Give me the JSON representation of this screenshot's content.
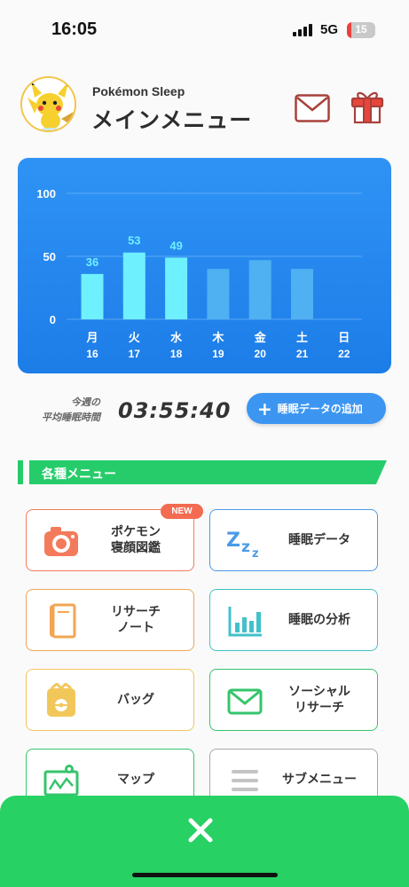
{
  "status_bar": {
    "time": "16:05",
    "network": "5G",
    "battery": "15",
    "battery_level": 0.15
  },
  "header": {
    "app_name": "Pokémon Sleep",
    "title": "メインメニュー",
    "mail_icon": "mail-icon",
    "gift_icon": "gift-icon"
  },
  "chart_data": {
    "type": "bar",
    "ylim": [
      0,
      100
    ],
    "yticks": [
      0,
      50,
      100
    ],
    "categories": [
      {
        "day": "月",
        "date": "16"
      },
      {
        "day": "火",
        "date": "17"
      },
      {
        "day": "水",
        "date": "18"
      },
      {
        "day": "木",
        "date": "19"
      },
      {
        "day": "金",
        "date": "20"
      },
      {
        "day": "土",
        "date": "21"
      },
      {
        "day": "日",
        "date": "22"
      }
    ],
    "values": [
      36,
      53,
      49,
      40,
      47,
      40,
      null
    ],
    "value_labels": [
      "36",
      "53",
      "49",
      "",
      "",
      "",
      ""
    ],
    "highlighted": [
      true,
      true,
      true,
      false,
      false,
      false,
      false
    ],
    "colors": {
      "highlight": "#6ff0ff",
      "normal": "#4fb0f2",
      "grid": "#7fc0f8",
      "text": "#ffffff"
    },
    "grid": true
  },
  "sleep_summary": {
    "label": "今週の\n平均睡眠時間",
    "value": "03:55:40"
  },
  "add_button": {
    "label": "睡眠データの追加",
    "icon": "plus-icon"
  },
  "section": {
    "title": "各種メニュー"
  },
  "menu": {
    "items": [
      {
        "label": "ポケモン\n寝顔図鑑",
        "icon": "camera-icon",
        "border": "#f47a5c",
        "badge": "NEW"
      },
      {
        "label": "睡眠データ",
        "icon": "zzz-icon",
        "border": "#4b9be8"
      },
      {
        "label": "リサーチ\nノート",
        "icon": "notebook-icon",
        "border": "#f2a654"
      },
      {
        "label": "睡眠の分析",
        "icon": "bar-chart-icon",
        "border": "#41c1c9"
      },
      {
        "label": "バッグ",
        "icon": "bag-icon",
        "border": "#f2c75a"
      },
      {
        "label": "ソーシャル\nリサーチ",
        "icon": "envelope-icon",
        "border": "#35c46b"
      },
      {
        "label": "マップ",
        "icon": "map-icon",
        "border": "#35c46b"
      },
      {
        "label": "サブメニュー",
        "icon": "hamburger-icon",
        "border": "#a8a8a8"
      }
    ]
  },
  "close_panel": {
    "icon": "close-icon"
  }
}
